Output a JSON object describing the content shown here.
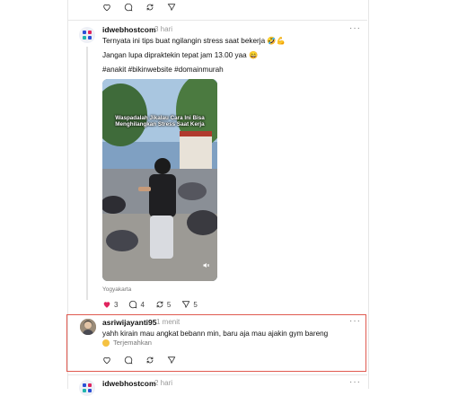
{
  "colors": {
    "highlight": "#e05a50",
    "like_active": "#e0245e",
    "divider": "#e6e6e6"
  },
  "top_post_actions": {
    "icons": [
      "heart-icon",
      "comment-icon",
      "repost-icon",
      "share-icon"
    ]
  },
  "post": {
    "username": "idwebhostcom",
    "time": "3 hari",
    "more": "···",
    "line1": "Ternyata ini tips buat ngilangin stress saat bekerja 🤣💪",
    "line2": "Jangan lupa dipraktekin tepat jam 13.00 yaa 😄",
    "hashtags": "#anakit #bikinwebsite #domainmurah",
    "video_caption_line1": "Waspadalah Jikalau Cara Ini Bisa",
    "video_caption_line2": "Menghilangkan Stress Saat Kerja",
    "location": "Yogyakarta",
    "likes": "3",
    "comments": "4",
    "reposts": "5",
    "shares": "5"
  },
  "reply": {
    "username": "asriwijayanti95",
    "time": "1 menit",
    "more": "···",
    "text": "yahh kirain mau angkat bebann min, baru aja mau ajakin gym bareng",
    "translate_label": "Terjemahkan"
  },
  "next_post": {
    "username": "idwebhostcom",
    "time": "2 hari",
    "more": "···"
  }
}
